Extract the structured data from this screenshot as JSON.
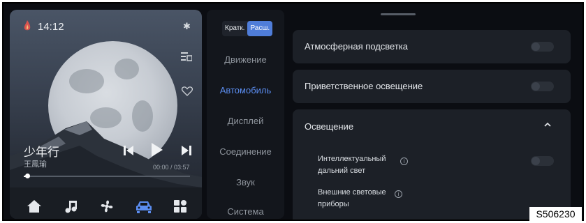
{
  "status_bar": {
    "time": "14:12"
  },
  "media": {
    "song_title": "少年行",
    "artist": "王鳳瑜",
    "time_text": "00:00 / 03:57",
    "progress": 0.02
  },
  "segment": {
    "brief": "Кратк.",
    "extended": "Расш."
  },
  "nav": {
    "items": [
      {
        "label": "Движение"
      },
      {
        "label": "Автомобиль"
      },
      {
        "label": "Дисплей"
      },
      {
        "label": "Соединение"
      },
      {
        "label": "Звук"
      },
      {
        "label": "Система"
      }
    ],
    "active_index": 1
  },
  "settings": {
    "ambient_light": "Атмосферная подсветка",
    "welcome_light": "Приветственное освещение",
    "lighting": "Освещение",
    "smart_high_beam": "Интеллектуальный\nдальний свет",
    "exterior_lights": "Внешние световые\nприборы"
  },
  "image_code": "S506230",
  "colors": {
    "accent": "#5b8df0",
    "background": "#0b0d12",
    "card": "#1c2027"
  }
}
